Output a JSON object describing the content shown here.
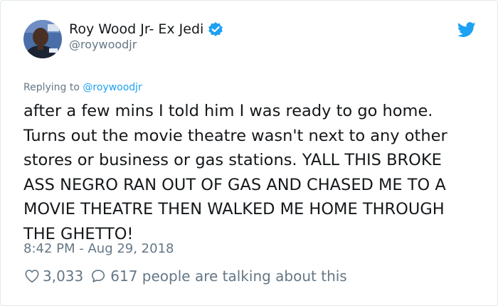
{
  "user": {
    "display_name": "Roy Wood Jr- Ex Jedi",
    "handle": "@roywoodjr",
    "verified": true
  },
  "reply": {
    "prefix": "Replying to ",
    "mention": "@roywoodjr"
  },
  "tweet": {
    "text": "after a few mins I told him I was ready to go home.\nTurns out the movie theatre wasn't next to any other\nstores or business or gas stations. YALL THIS BROKE\nASS NEGRO RAN OUT OF GAS AND CHASED ME TO A\nMOVIE THEATRE THEN WALKED ME HOME THROUGH\nTHE GHETTO!",
    "timestamp": "8:42 PM - Aug 29, 2018"
  },
  "engagement": {
    "likes": "3,033",
    "talking": "617 people are talking about this"
  },
  "icons": {
    "brand": "twitter-bird-icon",
    "verified": "verified-badge-icon",
    "like": "heart-icon",
    "reply": "speech-bubble-icon"
  },
  "colors": {
    "accent": "#1da1f2",
    "muted": "#657786",
    "text": "#14171a"
  }
}
